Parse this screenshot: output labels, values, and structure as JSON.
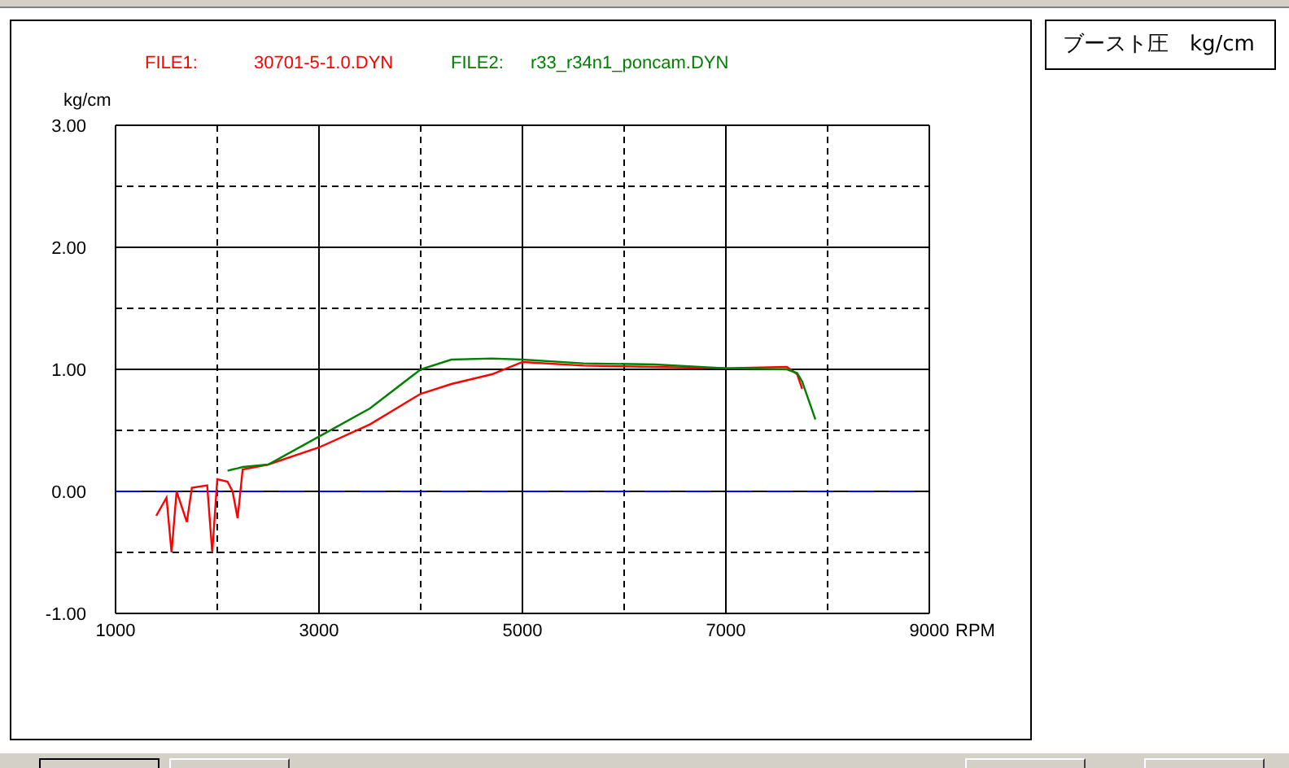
{
  "legend": [
    {
      "label": "FILE1:",
      "color": "#ff0000"
    },
    {
      "label": "FILE2:",
      "color": "#008000"
    }
  ],
  "title_box": "ブースト圧　kg/cm",
  "chart_data": {
    "type": "line",
    "ylabel": "kg/cm",
    "xlabel": "RPM",
    "xlim": [
      1000,
      9000
    ],
    "ylim": [
      -1,
      3
    ],
    "xticks": [
      1000,
      3000,
      5000,
      7000,
      9000
    ],
    "yticks": [
      {
        "value": 3,
        "label": "3.00"
      },
      {
        "value": 2,
        "label": "2.00"
      },
      {
        "value": 1,
        "label": "1.00"
      },
      {
        "value": 0,
        "label": "0.00"
      },
      {
        "value": -1,
        "label": "-1.00"
      }
    ],
    "x": [
      1400,
      1500,
      1550,
      1600,
      1700,
      1750,
      1900,
      1950,
      2000,
      2100,
      2150,
      2200,
      2250,
      2500,
      3000,
      3500,
      4000,
      4300,
      4700,
      5000,
      5600,
      6300,
      7000,
      7600,
      7700,
      7750,
      7880
    ],
    "series": [
      {
        "name": "30701-5-1.0.DYN",
        "color": "#ff0000",
        "values": [
          -0.2,
          -0.05,
          -0.5,
          0.0,
          -0.25,
          0.03,
          0.05,
          -0.5,
          0.1,
          0.08,
          0.0,
          -0.22,
          0.18,
          0.22,
          0.36,
          0.55,
          0.8,
          0.88,
          0.96,
          1.06,
          1.03,
          1.02,
          1.01,
          1.02,
          0.96,
          0.84,
          null
        ]
      },
      {
        "name": "r33_r34n1_poncam.DYN",
        "color": "#008000",
        "values": [
          null,
          null,
          null,
          null,
          null,
          null,
          null,
          null,
          null,
          0.17,
          0.18,
          0.19,
          0.2,
          0.22,
          0.45,
          0.68,
          1.0,
          1.08,
          1.09,
          1.08,
          1.05,
          1.04,
          1.01,
          1.0,
          0.97,
          0.9,
          0.59
        ]
      }
    ],
    "grid": true,
    "ref_lines": [
      {
        "axis": "y",
        "value": 0,
        "color": "#0000ff"
      }
    ]
  }
}
